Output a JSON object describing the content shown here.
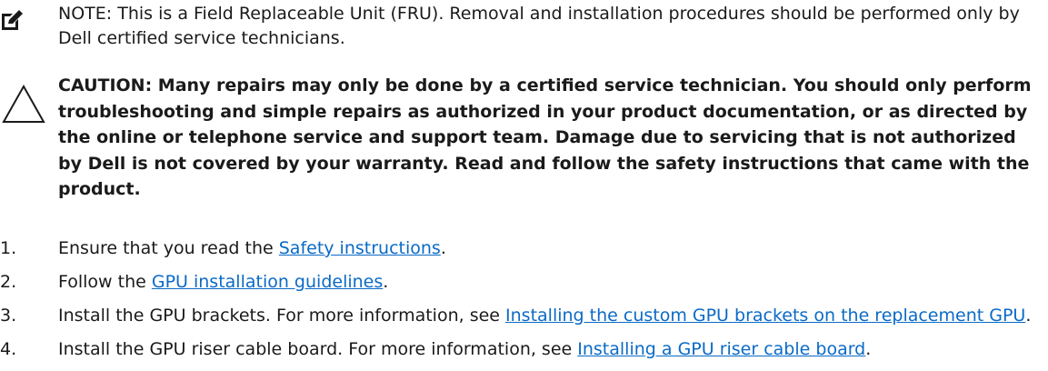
{
  "note": {
    "label": "NOTE:",
    "text": "This is a Field Replaceable Unit (FRU). Removal and installation procedures should be performed only by Dell certified service technicians.",
    "icon": "pencil-note-icon"
  },
  "caution": {
    "text": "CAUTION: Many repairs may only be done by a certified service technician. You should only perform troubleshooting and simple repairs as authorized in your product documentation, or as directed by the online or telephone service and support team. Damage due to servicing that is not authorized by Dell is not covered by your warranty. Read and follow the safety instructions that came with the product.",
    "icon": "warning-triangle-icon"
  },
  "steps": [
    {
      "num": "1.",
      "before": "Ensure that you read the ",
      "link": "Safety instructions",
      "after": "."
    },
    {
      "num": "2.",
      "before": "Follow the ",
      "link": "GPU installation guidelines",
      "after": "."
    },
    {
      "num": "3.",
      "before": "Install the GPU brackets. For more information, see ",
      "link": "Installing the custom GPU brackets on the replacement GPU",
      "after": "."
    },
    {
      "num": "4.",
      "before": "Install the GPU riser cable board. For more information, see ",
      "link": "Installing a GPU riser cable board",
      "after": "."
    }
  ],
  "colors": {
    "text": "#1a1a1a",
    "link": "#0a6ac6"
  }
}
